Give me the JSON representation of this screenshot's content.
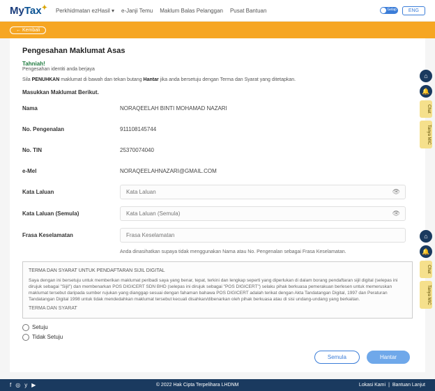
{
  "header": {
    "logo": "MyTax",
    "nav": [
      "Perkhidmatan ezHasil ▾",
      "e-Janji Temu",
      "Maklum Balas Pelanggan",
      "Pusat Bantuan"
    ],
    "toggle_label": "Gelap",
    "lang": "ENG"
  },
  "back": "← Kembali",
  "page": {
    "title": "Pengesahan Maklumat Asas",
    "tahniah": "Tahniah!",
    "tahniah_sub": "Pengesahan identiti anda berjaya",
    "instr_pre": "Sila ",
    "instr_b1": "PENUHKAN",
    "instr_mid": " maklumat di bawah dan tekan butang ",
    "instr_b2": "Hantar",
    "instr_post": " jika anda bersetuju dengan Terma dan Syarat yang ditetapkan.",
    "section": "Masukkan Maklumat Berikut."
  },
  "fields": {
    "nama_l": "Nama",
    "nama_v": "NORAQEELAH BINTI MOHAMAD NAZARI",
    "nop_l": "No. Pengenalan",
    "nop_v": "911108145744",
    "tin_l": "No. TIN",
    "tin_v": "25370074040",
    "emel_l": "e-Mel",
    "emel_v": "NORAQEELAHNAZARI@GMAIL.COM",
    "kl_l": "Kata Laluan",
    "kl_ph": "Kata Laluan",
    "kls_l": "Kata Laluan (Semula)",
    "kls_ph": "Kata Laluan (Semula)",
    "fk_l": "Frasa Keselamatan",
    "fk_ph": "Frasa Keselamatan",
    "hint": "Anda dinasihatkan supaya tidak menggunakan Nama atau No. Pengenalan sebagai Frasa Keselamatan."
  },
  "terms": {
    "title": "TERMA DAN SYARAT UNTUK PENDAFTARAN SIJIL DIGITAL",
    "body": "Saya dengan ini bersetuju untuk memberikan maklumat peribadi saya yang benar, tepat, terkini dan lengkap seperti yang diperlukan di dalam borang pendaftaran sijil digital (selepas ini dirujuk sebagai \"Sijil\") dan membenarkan POS DIGICERT SDN BHD (selepas ini dirujuk sebagai \"POS DIGICERT\") selaku pihak berkuasa pemerakuan berlesen untuk memeruskan maklumat tersebut daripada sumber rujukan yang dianggap sesuai dengan fahaman bahawa POS DIGICERT adalah terikat dengan Akta Tandatangan Digital, 1997 dan Peraturan Tandatangan Digital 1998 untuk tidak mendedahkan maklumat tersebut kecuali disahkan/dibenarkan oleh pihak berkuasa atau di sisi undang-undang yang berkaitan.",
    "sub": "TERMA DAN SYARAT"
  },
  "radio": {
    "agree": "Setuju",
    "disagree": "Tidak Setuju"
  },
  "buttons": {
    "reset": "Semula",
    "submit": "Hantar"
  },
  "footer": {
    "copy": "© 2022 Hak Cipta Terpelihara LHDNM",
    "loc": "Lokasi Kami",
    "help": "Bantuan Lanjut",
    "sep": " | "
  },
  "side": {
    "chat": "Chat",
    "tanya": "Tanya MIC"
  }
}
